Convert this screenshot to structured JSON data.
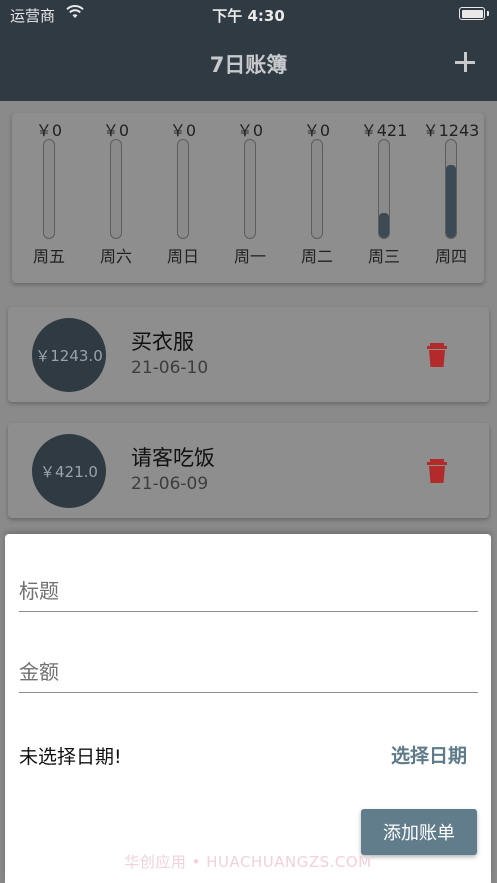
{
  "status_bar": {
    "carrier": "运营商",
    "time": "下午 4:30"
  },
  "app_bar": {
    "title": "7日账簿",
    "add_icon": "plus-icon"
  },
  "chart_data": {
    "type": "bar",
    "categories": [
      "周五",
      "周六",
      "周日",
      "周一",
      "周二",
      "周三",
      "周四"
    ],
    "values": [
      0,
      0,
      0,
      0,
      0,
      421,
      1243
    ],
    "value_labels": [
      "￥0",
      "￥0",
      "￥0",
      "￥0",
      "￥0",
      "￥421",
      "￥1243"
    ],
    "ylim": [
      0,
      1664
    ],
    "colors": {
      "fill": "#3b4a54",
      "track": "#8a8a8a"
    }
  },
  "bills": [
    {
      "amount": "￥1243.0",
      "title": "买衣服",
      "date": "21-06-10"
    },
    {
      "amount": "￥421.0",
      "title": "请客吃饭",
      "date": "21-06-09"
    }
  ],
  "sheet": {
    "title_placeholder": "标题",
    "amount_placeholder": "金额",
    "date_status": "未选择日期!",
    "choose_date_label": "选择日期",
    "submit_label": "添加账单",
    "watermark": "华创应用 • HUACHUANGZS.COM"
  },
  "colors": {
    "appbar": "#2f3a42",
    "accent": "#617d8c",
    "delete": "#b22a2a"
  }
}
